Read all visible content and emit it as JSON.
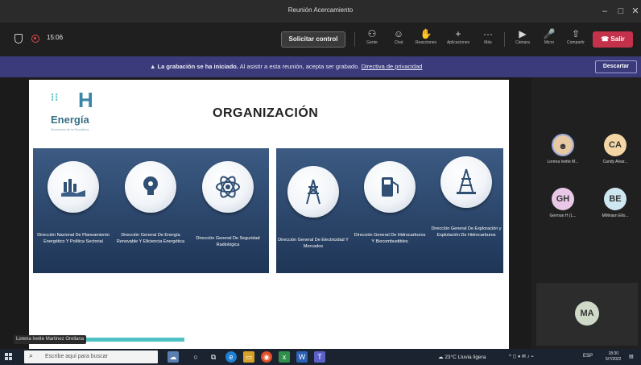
{
  "window": {
    "title": "Reunión Acercamiento",
    "minimize": "–",
    "maximize": "□",
    "close": "✕"
  },
  "toolbar": {
    "timer": "15:06",
    "request_control": "Solicitar control",
    "tools": [
      {
        "icon": "⚇",
        "label": "Gente"
      },
      {
        "icon": "☺",
        "label": "Chat"
      },
      {
        "icon": "✋",
        "label": "Reacciones"
      },
      {
        "icon": "+",
        "label": "Aplicaciones"
      },
      {
        "icon": "···",
        "label": "Más"
      },
      {
        "icon": "▶",
        "label": "Cámara"
      },
      {
        "icon": "🎤",
        "label": "Micro"
      },
      {
        "icon": "⇧",
        "label": "Compartir"
      }
    ],
    "leave": "Salir"
  },
  "banner": {
    "strong": "La grabación se ha iniciado.",
    "text": "Al asistir a esta reunión, acepta ser grabado.",
    "link": "Directiva de privacidad",
    "dismiss": "Descartar"
  },
  "slide": {
    "logo_h": "H",
    "logo_name": "Energía",
    "logo_sub": "Secretaría de la República",
    "title": "ORGANIZACIÓN",
    "units_left": [
      {
        "label": "Dirección Nacional De Planeamiento Energético Y Política Sectorial",
        "icon": "chart-hand-icon"
      },
      {
        "label": "Dirección General De Energía Renovable Y Eficiencia Energética",
        "icon": "bulb-icon"
      },
      {
        "label": "Dirección General De Seguridad Radiológica",
        "icon": "atom-icon"
      }
    ],
    "units_right": [
      {
        "label": "Dirección General De Electricidad Y Mercados",
        "icon": "power-tower-icon"
      },
      {
        "label": "Dirección General De Hidrocarburos Y Biocombustibles",
        "icon": "fuel-pump-icon"
      },
      {
        "label": "Dirección General De Exploración y Explotación De Hidrocarburos",
        "icon": "oil-rig-icon"
      }
    ],
    "presenter": "Lorena Ivette Martinez Orellana"
  },
  "participants": [
    {
      "initials": "",
      "name": "Lorena Ivette M...",
      "color": "#e6c9a2"
    },
    {
      "initials": "CA",
      "name": "Candy Alvar...",
      "color": "#f3d6a4"
    },
    {
      "initials": "GH",
      "name": "German H (L...",
      "color": "#e8c8e6"
    },
    {
      "initials": "BE",
      "name": "MMiriam Ello...",
      "color": "#cde6ef"
    }
  ],
  "self": {
    "initials": "MA"
  },
  "taskbar": {
    "search_placeholder": "Escribe aquí para buscar",
    "weather": "23°C  Lluvia ligera",
    "lang": "ESP",
    "time": "18:30",
    "date": "5/7/2022"
  }
}
